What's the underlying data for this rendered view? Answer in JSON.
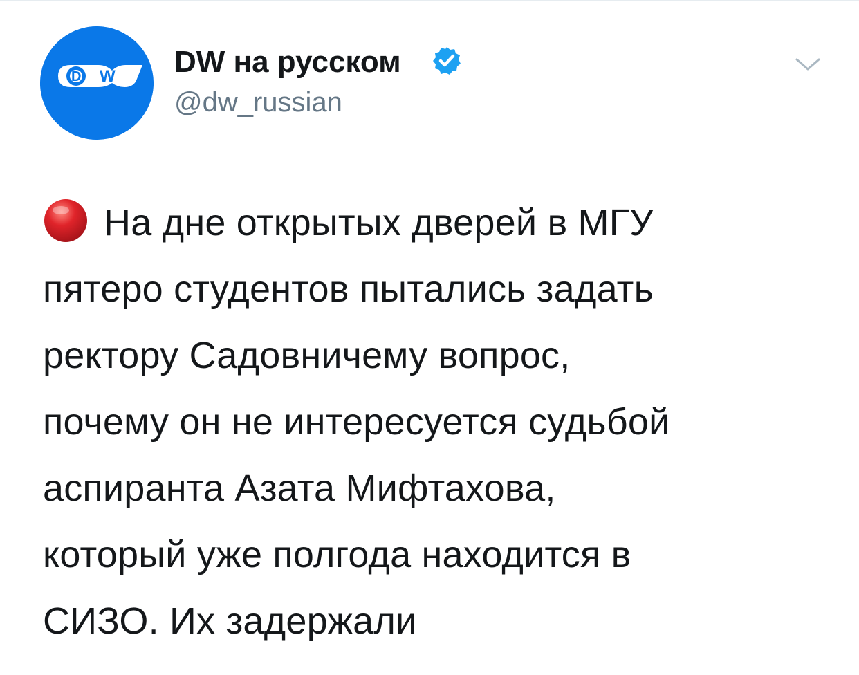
{
  "author": {
    "name": "DW на русском",
    "handle": "@dw_russian",
    "avatar_logo_text": "DW",
    "verified": true
  },
  "icons": {
    "verified": "verified-badge-icon",
    "caret": "chevron-down-icon",
    "emoji": "red-circle-emoji-icon"
  },
  "colors": {
    "brand_blue": "#0a78e8",
    "verified_blue": "#1da1f2",
    "emoji_red": "#e0242a",
    "handle_gray": "#657786"
  },
  "tweet": {
    "lines": [
      "На дне открытых дверей в МГУ",
      "пятеро студентов пытались задать",
      "ректору Садовничему вопрос,",
      "почему он не интересуется судьбой",
      "аспиранта Азата Мифтахова,",
      "который уже полгода находится в",
      "СИЗО. Их задержали"
    ]
  }
}
